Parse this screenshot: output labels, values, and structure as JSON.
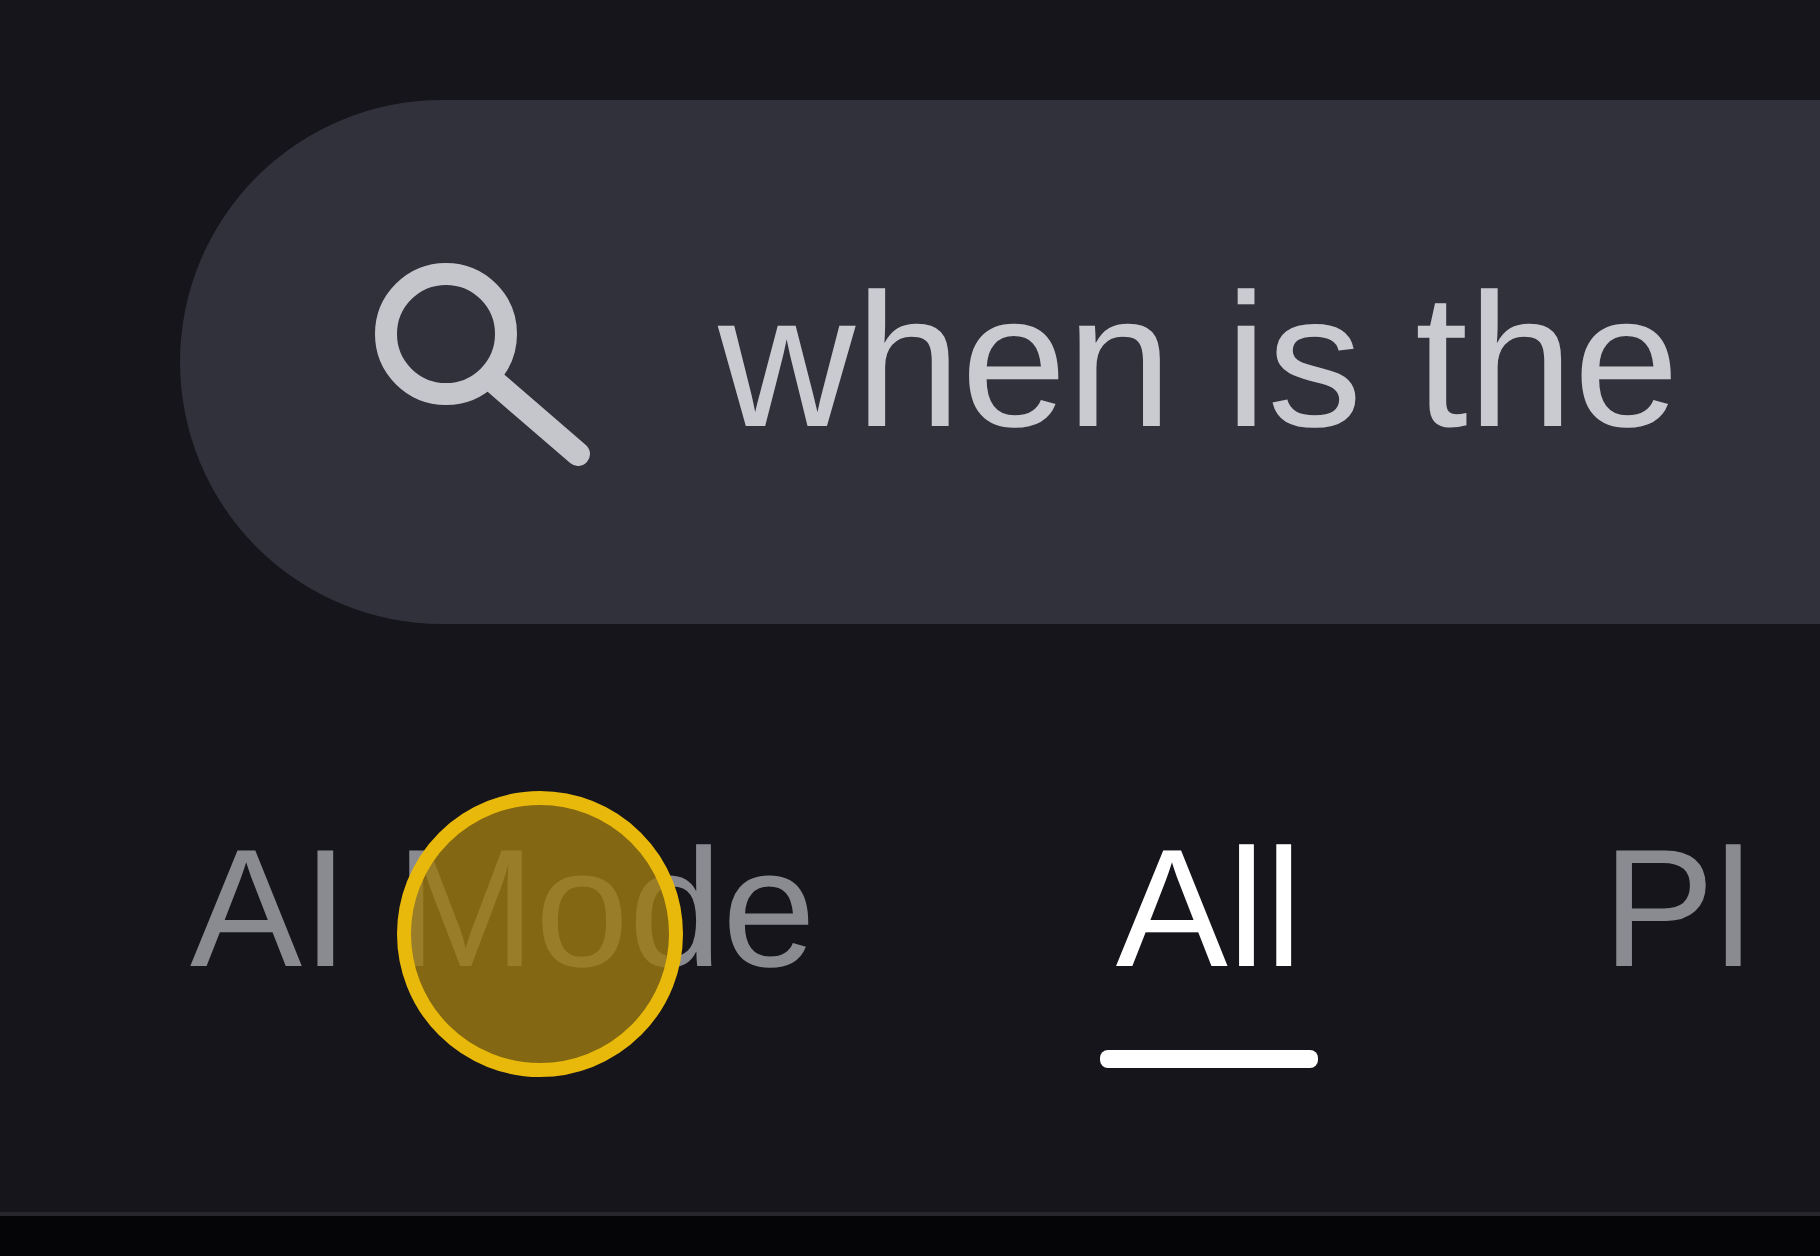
{
  "search": {
    "query": "when is the"
  },
  "tabs": [
    {
      "label": "AI Mode",
      "selected": false
    },
    {
      "label": "All",
      "selected": true
    },
    {
      "label": "Pl",
      "selected": false
    }
  ]
}
